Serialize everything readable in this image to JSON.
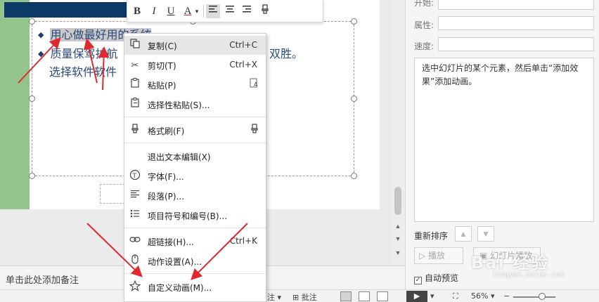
{
  "slide": {
    "line1": "用心做最好用的系统",
    "line2": "质量保驾护航",
    "line2_tail": "双胜。",
    "line3": "选择软件软件"
  },
  "mini_toolbar": {
    "buttons": [
      "B",
      "I",
      "U",
      "A",
      "▾",
      "left-align",
      "center-align",
      "right-align",
      "clear-format"
    ]
  },
  "context_menu": {
    "items": [
      {
        "icon": "copy-icon",
        "label": "复制(C)",
        "shortcut": "Ctrl+C"
      },
      {
        "icon": "cut-icon",
        "label": "剪切(T)",
        "shortcut": "Ctrl+X"
      },
      {
        "icon": "paste-icon",
        "label": "粘贴(P)",
        "shortcut": ""
      },
      {
        "icon": "paste-special-icon",
        "label": "选择性粘贴(S)...",
        "shortcut": ""
      },
      {
        "icon": "format-painter-icon",
        "label": "格式刷(F)",
        "shortcut": ""
      },
      {
        "icon": "",
        "label": "退出文本编辑(X)",
        "shortcut": ""
      },
      {
        "icon": "font-icon",
        "label": "字体(F)...",
        "shortcut": ""
      },
      {
        "icon": "paragraph-icon",
        "label": "段落(P)...",
        "shortcut": ""
      },
      {
        "icon": "bullets-icon",
        "label": "项目符号和编号(B)...",
        "shortcut": ""
      },
      {
        "icon": "hyperlink-icon",
        "label": "超链接(H)...",
        "shortcut": "Ctrl+K"
      },
      {
        "icon": "action-icon",
        "label": "动作设置(A)...",
        "shortcut": ""
      },
      {
        "icon": "custom-animation-icon",
        "label": "自定义动画(M)...",
        "shortcut": ""
      }
    ]
  },
  "right_panel": {
    "start_label": "开始:",
    "property_label": "属性:",
    "speed_label": "速度:",
    "description": "选中幻灯片的某个元素，然后单击“添加效果”添加动画。",
    "reorder_label": "重新排序",
    "play_label": "播放",
    "slideshow_label": "幻灯片播放",
    "auto_preview_label": "自动预览"
  },
  "notes": {
    "placeholder": "单击此处添加备注"
  },
  "status_bar": {
    "item_a": "注 ▾",
    "item_b": "批注",
    "zoom": "56%"
  },
  "watermark": {
    "main": "Bai 经验",
    "sub": "jingyan.baidu.com"
  },
  "colors": {
    "green_bar": "#93c48b",
    "blue_band": "#0c3a66",
    "arrow": "#e0282d",
    "menu_hover": "#e6e6e6"
  }
}
